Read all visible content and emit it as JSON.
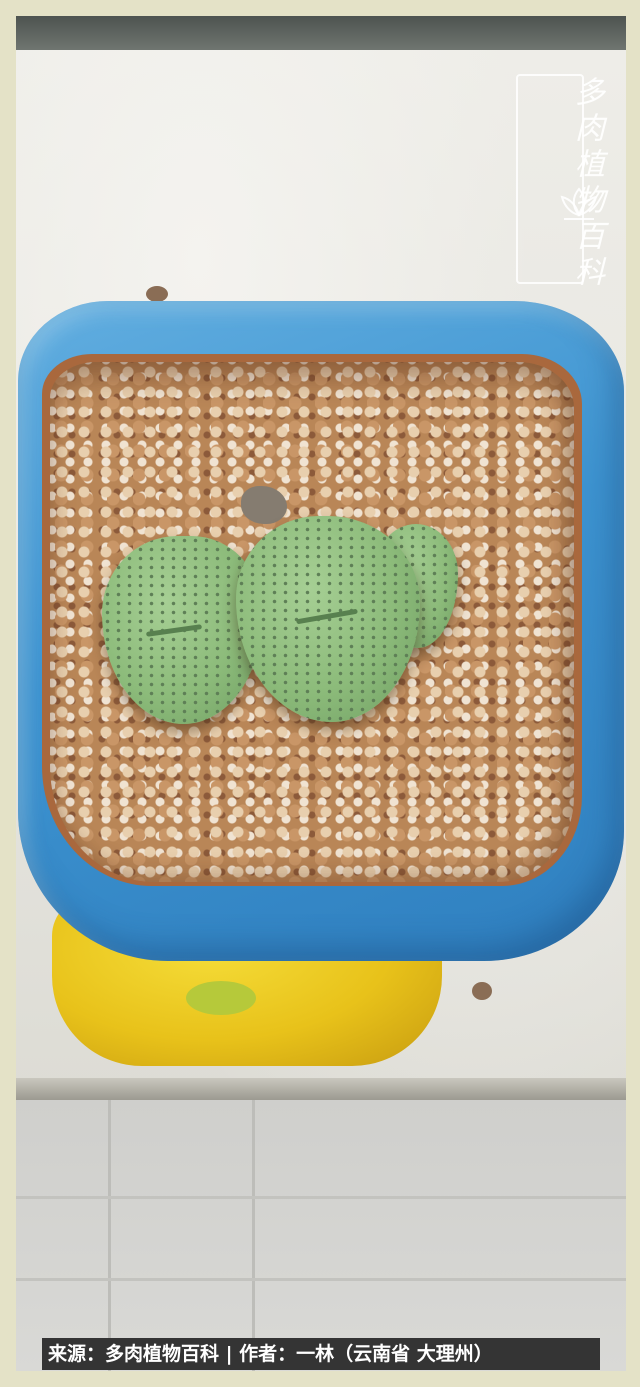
{
  "photo": {
    "subject": "lithops-in-blue-pot"
  },
  "watermark": {
    "text": "多肉植物百科"
  },
  "caption": {
    "text": "来源：多肉植物百科 | 作者：一林（云南省 大理州）"
  },
  "colors": {
    "border": "#e4e2c7",
    "pot_blue": "#3d93d0",
    "pot_yellow": "#e8c21a",
    "leaf_green": "#8cbb7a",
    "caption_bg": "#343434"
  }
}
